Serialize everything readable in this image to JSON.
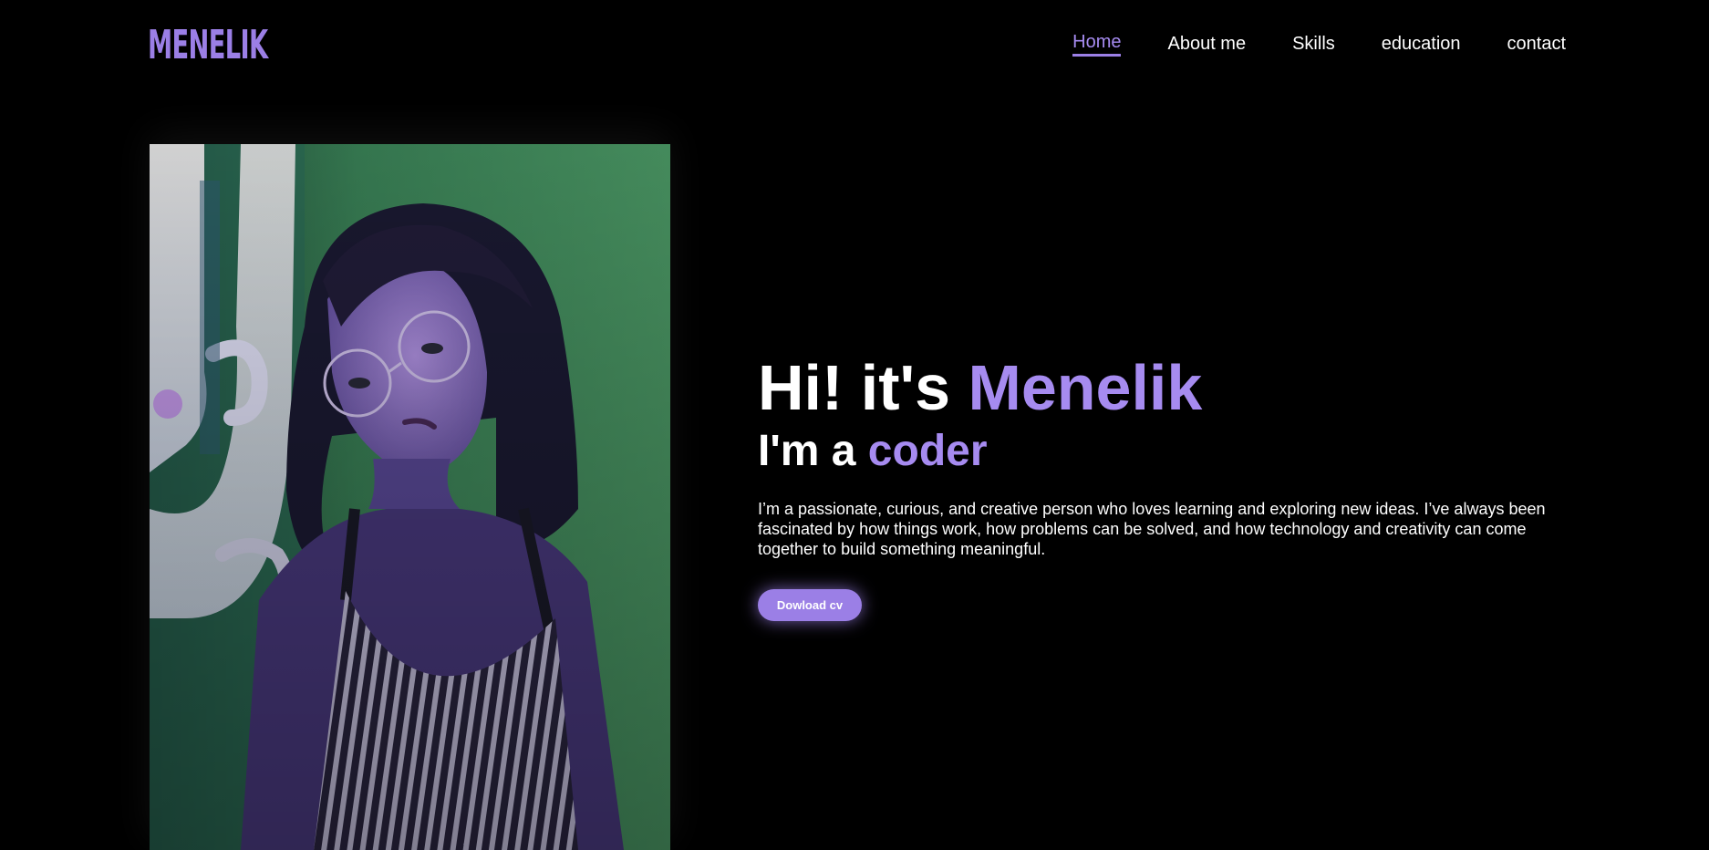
{
  "brand": {
    "logo": "MENELIK",
    "accent_color": "#9b7fe6"
  },
  "nav": {
    "items": [
      {
        "label": "Home",
        "active": true
      },
      {
        "label": "About me",
        "active": false
      },
      {
        "label": "Skills",
        "active": false
      },
      {
        "label": "education",
        "active": false
      },
      {
        "label": "contact",
        "active": false
      }
    ]
  },
  "hero": {
    "greeting_prefix": "Hi! it's ",
    "name": "Menelik",
    "subtitle_prefix": "I'm a ",
    "role": "coder",
    "bio": "I’m a passionate, curious, and creative person who loves learning and exploring new ideas. I’ve always been fascinated by how things work, how problems can be solved, and how technology and creativity can come together to build something meaningful.",
    "cv_button_label": "Dowload cv"
  },
  "photo": {
    "icon": "portrait-photo"
  },
  "colors": {
    "background": "#000000",
    "text": "#ffffff",
    "accent": "#a68bf0"
  }
}
